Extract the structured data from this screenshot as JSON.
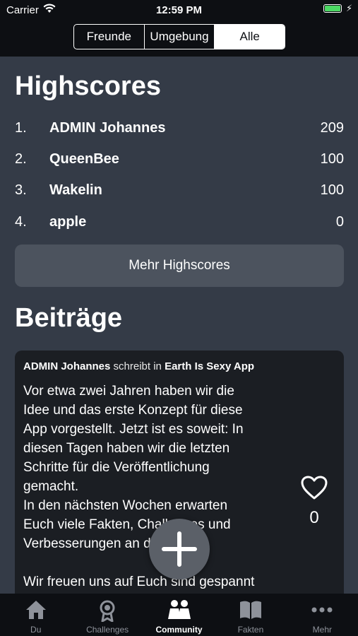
{
  "status_bar": {
    "carrier": "Carrier",
    "time": "12:59 PM"
  },
  "segments": [
    {
      "label": "Freunde",
      "selected": false
    },
    {
      "label": "Umgebung",
      "selected": false
    },
    {
      "label": "Alle",
      "selected": true
    }
  ],
  "highscores": {
    "title": "Highscores",
    "rows": [
      {
        "rank": "1.",
        "name": "ADMIN Johannes",
        "score": "209"
      },
      {
        "rank": "2.",
        "name": "QueenBee",
        "score": "100"
      },
      {
        "rank": "3.",
        "name": "Wakelin",
        "score": "100"
      },
      {
        "rank": "4.",
        "name": "apple",
        "score": "0"
      }
    ],
    "more_button": "Mehr Highscores"
  },
  "posts": {
    "title": "Beiträge",
    "items": [
      {
        "author": "ADMIN Johannes",
        "verb": "schreibt in",
        "group": "Earth Is Sexy App",
        "text": "Vor etwa zwei Jahren haben wir die\nIdee und das erste Konzept für diese\nApp vorgestellt. Jetzt ist es soweit: In\ndiesen Tagen haben wir die letzten\nSchritte für die Veröffentlichung\ngemacht.\nIn den nächsten Wochen erwarten\nEuch viele Fakten, Challenges und\nVerbesserungen an der App.\n\nWir freuen uns auf Euch sind gespannt",
        "likes": "0"
      }
    ]
  },
  "tabs": [
    {
      "label": "Du",
      "icon": "home-icon",
      "active": false
    },
    {
      "label": "Challenges",
      "icon": "medal-icon",
      "active": false
    },
    {
      "label": "Community",
      "icon": "people-icon",
      "active": true
    },
    {
      "label": "Fakten",
      "icon": "book-icon",
      "active": false
    },
    {
      "label": "Mehr",
      "icon": "more-dots-icon",
      "active": false
    }
  ],
  "colors": {
    "accent_battery": "#4cd964",
    "background": "#343b47",
    "card": "#1b1e23",
    "bar": "#0d0f13"
  }
}
